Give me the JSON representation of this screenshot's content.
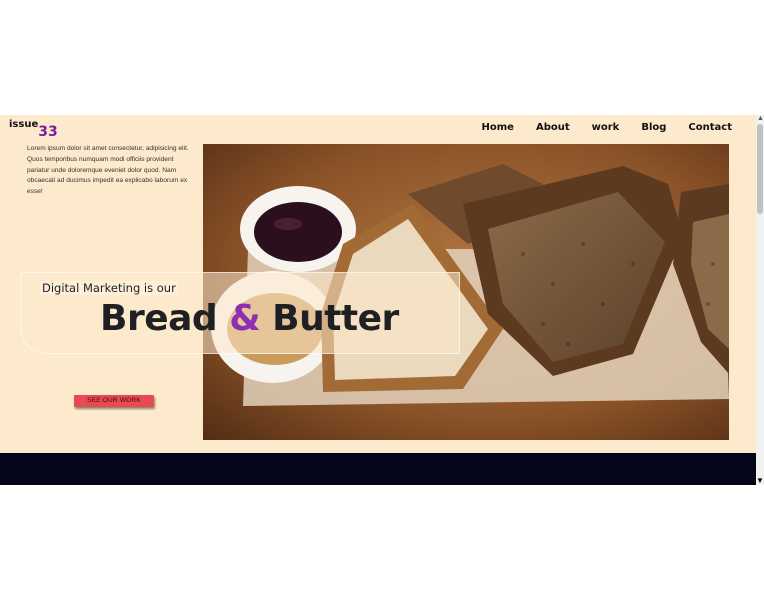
{
  "brand": {
    "word": "issue",
    "number": "33"
  },
  "nav": {
    "items": [
      "Home",
      "About",
      "work",
      "Blog",
      "Contact"
    ]
  },
  "intro": {
    "text": "Lorem ipsum dolor sit amet consectetur, adipisicing elit. Quos temporibus numquam modi officiis provident pariatur unde doloremque eveniet dolor quod. Nam obcaecati ad ducimus impedit ea explicabo laborum ex esse!"
  },
  "hero": {
    "tagline": "Digital Marketing is our",
    "headline_part1": "Bread ",
    "headline_amp": "&",
    "headline_part2": " Butter",
    "cta_label": "SEE OUR WORK"
  },
  "colors": {
    "page_background": "#fde9cc",
    "accent_purple": "#8e2eb3",
    "cta_red": "#e84a52",
    "footer_band": "#06061a"
  },
  "scrollbar": {
    "up_icon": "▲",
    "down_icon": "▼"
  }
}
